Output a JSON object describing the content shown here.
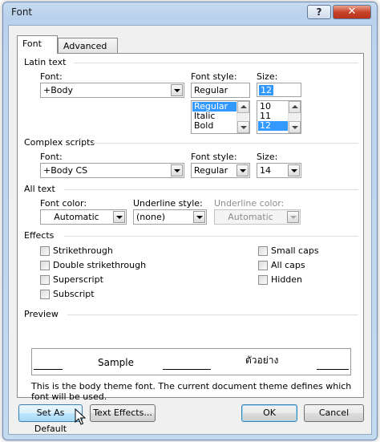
{
  "window": {
    "title": "Font",
    "help_label": "?",
    "close_label": "✕"
  },
  "tabs": [
    {
      "label": "Font",
      "selected": true
    },
    {
      "label": "Advanced",
      "selected": false
    }
  ],
  "latin": {
    "group_label": "Latin text",
    "font_label": "Font:",
    "font_value": "+Body",
    "style_label": "Font style:",
    "style_value": "Regular",
    "style_options": [
      "Regular",
      "Italic",
      "Bold"
    ],
    "size_label": "Size:",
    "size_value": "12",
    "size_options": [
      "10",
      "11",
      "12"
    ]
  },
  "complex": {
    "group_label": "Complex scripts",
    "font_label": "Font:",
    "font_value": "+Body CS",
    "style_label": "Font style:",
    "style_value": "Regular",
    "size_label": "Size:",
    "size_value": "14"
  },
  "all_text": {
    "group_label": "All text",
    "color_label": "Font color:",
    "color_value": "Automatic",
    "underline_label": "Underline style:",
    "underline_value": "(none)",
    "underline_color_label": "Underline color:",
    "underline_color_value": "Automatic"
  },
  "effects": {
    "group_label": "Effects",
    "left": [
      "Strikethrough",
      "Double strikethrough",
      "Superscript",
      "Subscript"
    ],
    "right": [
      "Small caps",
      "All caps",
      "Hidden"
    ]
  },
  "preview": {
    "group_label": "Preview",
    "sample": "Sample",
    "complex_sample": "ตัวอย่าง",
    "description": "This is the body theme font. The current document theme defines which font will be used."
  },
  "buttons": {
    "set_default": "Set As Default",
    "text_effects": "Text Effects...",
    "ok": "OK",
    "cancel": "Cancel"
  },
  "colors": {
    "accent": "#3399ff",
    "titlebar": "#bfd5ee",
    "close": "#c7442a"
  }
}
